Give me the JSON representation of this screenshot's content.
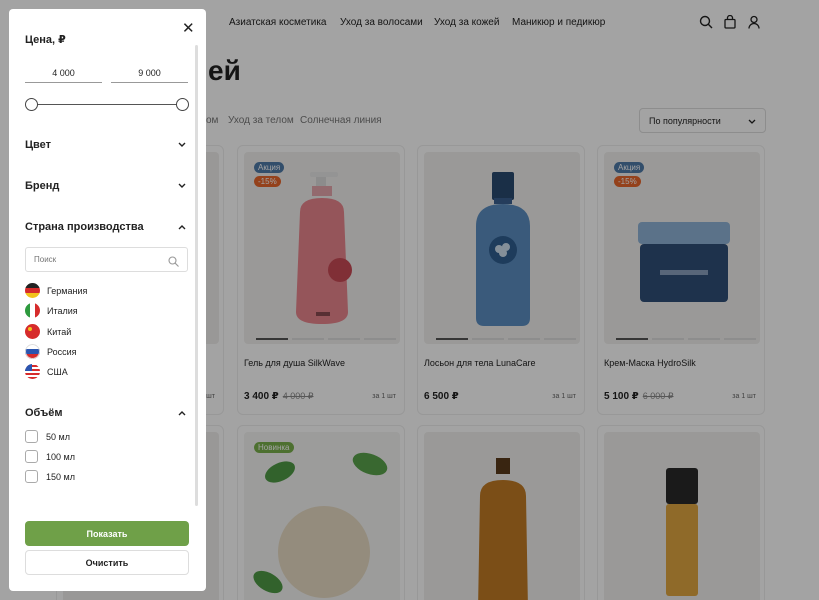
{
  "nav": {
    "items": [
      "Азиатская косметика",
      "Уход за волосами",
      "Уход за кожей",
      "Маникюр и педикюр"
    ],
    "icons": [
      "search-icon",
      "bag-icon",
      "user-icon"
    ]
  },
  "page": {
    "title_partial": "ей",
    "tabs_partial": [
      "ом",
      "Уход за телом",
      "Солнечная линия"
    ],
    "sort": {
      "selected": "По популярности"
    }
  },
  "products": [
    {
      "name": "Гель для душа SilkWave",
      "price": "3 400 ₽",
      "old_price": "4 000 ₽",
      "unit": "за 1 шт",
      "badges": [
        "Акция",
        "-15%"
      ]
    },
    {
      "name": "Лосьон для тела LunaCare",
      "price": "6 500 ₽",
      "old_price": "",
      "unit": "за 1 шт",
      "badges": []
    },
    {
      "name": "Крем-Маска HydroSilk",
      "price": "5 100 ₽",
      "old_price": "6 000 ₽",
      "unit": "за 1 шт",
      "badges": [
        "Акция",
        "-15%"
      ]
    },
    {
      "name": "",
      "price": "",
      "old_price": "",
      "unit": "",
      "badges": [
        "Новинка"
      ]
    }
  ],
  "partial_unit": "за 1 шт",
  "filter": {
    "price_title": "Цена, ₽",
    "price_min": "4 000",
    "price_max": "9 000",
    "sections": {
      "color": "Цвет",
      "brand": "Бренд",
      "country": "Страна производства",
      "volume": "Объём"
    },
    "country_search_placeholder": "Поиск",
    "countries": [
      "Германия",
      "Италия",
      "Китай",
      "Россия",
      "США"
    ],
    "volumes": [
      "50 мл",
      "100 мл",
      "150 мл"
    ],
    "show_label": "Показать",
    "clear_label": "Очистить"
  },
  "colors": {
    "accent": "#6fa048",
    "sale": "#4f7aa8",
    "discount": "#e8662b",
    "new": "#79b04c"
  }
}
